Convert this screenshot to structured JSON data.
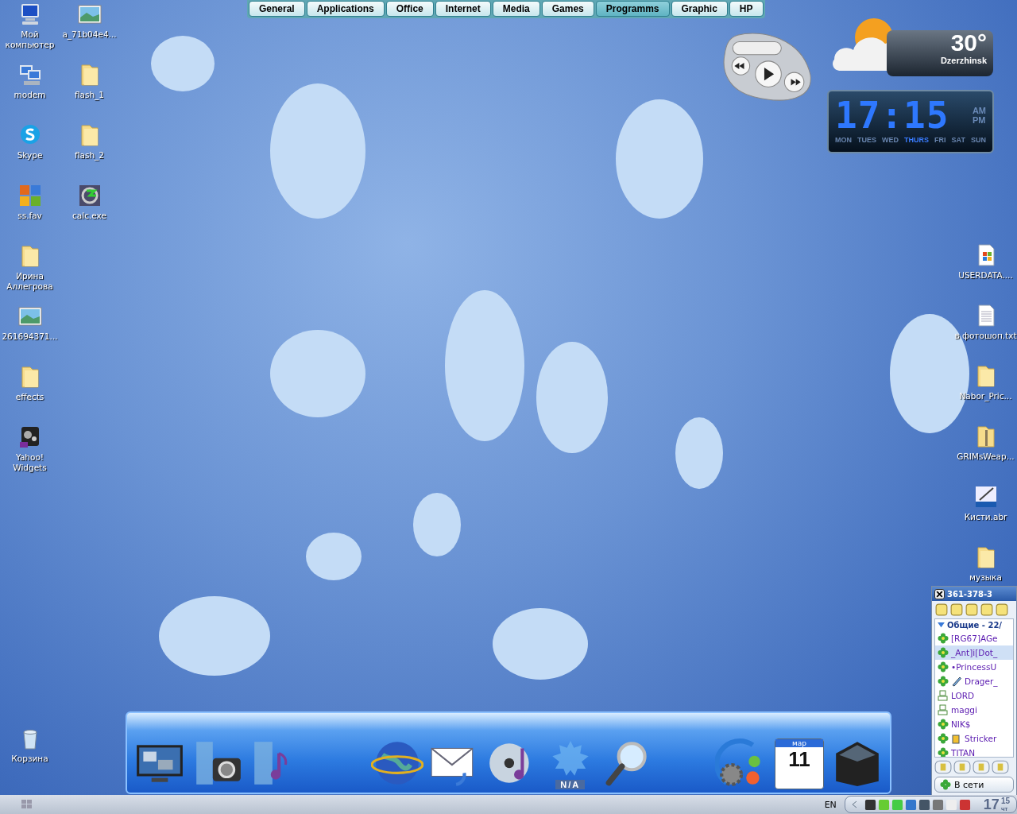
{
  "menu_tabs": [
    {
      "label": "General",
      "selected": false
    },
    {
      "label": "Applications",
      "selected": false
    },
    {
      "label": "Office",
      "selected": false
    },
    {
      "label": "Internet",
      "selected": false
    },
    {
      "label": "Media",
      "selected": false
    },
    {
      "label": "Games",
      "selected": false
    },
    {
      "label": "Programms",
      "selected": true
    },
    {
      "label": "Graphic",
      "selected": false
    },
    {
      "label": "HP",
      "selected": false
    }
  ],
  "desktop_icons_left": [
    {
      "label": "Мой компьютер",
      "kind": "computer"
    },
    {
      "label": "modem",
      "kind": "network"
    },
    {
      "label": "Skype",
      "kind": "chat"
    },
    {
      "label": "ss.fav",
      "kind": "squares"
    },
    {
      "label": "Ирина Аллегрова",
      "kind": "folder"
    },
    {
      "label": "261694371...",
      "kind": "image"
    },
    {
      "label": "effects",
      "kind": "folder"
    },
    {
      "label": "Yahoo! Widgets",
      "kind": "gears"
    }
  ],
  "desktop_icons_second": [
    {
      "label": "a_71b04e4...",
      "kind": "image"
    },
    {
      "label": "flash_1",
      "kind": "folder"
    },
    {
      "label": "flash_2",
      "kind": "folder"
    },
    {
      "label": "calc.exe",
      "kind": "program"
    }
  ],
  "desktop_icons_right": [
    {
      "label": "USERDATA....",
      "kind": "document"
    },
    {
      "label": "в фотошоп.txt",
      "kind": "text"
    },
    {
      "label": "Nabor_Pric...",
      "kind": "folder"
    },
    {
      "label": "GRIMsWeap...",
      "kind": "zip"
    },
    {
      "label": "Кисти.abr",
      "kind": "brush"
    },
    {
      "label": "музыка",
      "kind": "folder"
    }
  ],
  "recycle_bin": {
    "label": "Корзина"
  },
  "weather": {
    "temperature": "30°",
    "city": "Dzerzhinsk"
  },
  "clock": {
    "time": "17:15",
    "am_label": "AM",
    "pm_label": "PM",
    "days": [
      {
        "label": "MON",
        "selected": false
      },
      {
        "label": "TUES",
        "selected": false
      },
      {
        "label": "WED",
        "selected": false
      },
      {
        "label": "THURS",
        "selected": true
      },
      {
        "label": "FRI",
        "selected": false
      },
      {
        "label": "SAT",
        "selected": false
      },
      {
        "label": "SUN",
        "selected": false
      }
    ]
  },
  "dock": {
    "items": [
      {
        "kind": "monitor"
      },
      {
        "kind": "camera"
      },
      {
        "kind": "music"
      },
      {
        "kind": "globe"
      },
      {
        "kind": "mail"
      },
      {
        "kind": "disc"
      },
      {
        "kind": "na",
        "label": "N/A"
      },
      {
        "kind": "search"
      },
      {
        "kind": "settings"
      },
      {
        "kind": "calendar",
        "month": "мар",
        "day": "11"
      },
      {
        "kind": "box"
      }
    ]
  },
  "icq": {
    "title": "361-378-3",
    "group": "Общие - 22/",
    "status_button": "В сети",
    "contacts": [
      {
        "name": "[RG67]AGe",
        "kind": "online",
        "selected": false
      },
      {
        "name": "_Ant]i[Dot_",
        "kind": "online",
        "selected": true
      },
      {
        "name": "•PrincessU",
        "kind": "online",
        "selected": false
      },
      {
        "name": "Drager_",
        "kind": "online-note",
        "selected": false
      },
      {
        "name": "LORD",
        "kind": "offline",
        "selected": false
      },
      {
        "name": "maggi",
        "kind": "offline",
        "selected": false
      },
      {
        "name": "NIK$",
        "kind": "online",
        "selected": false
      },
      {
        "name": "Stricker",
        "kind": "online-mug",
        "selected": false
      },
      {
        "name": "TITAN",
        "kind": "online",
        "selected": false
      }
    ]
  },
  "taskbar": {
    "language": "EN",
    "clock_hour": "17",
    "clock_minute": "15",
    "clock_day": "чт"
  }
}
